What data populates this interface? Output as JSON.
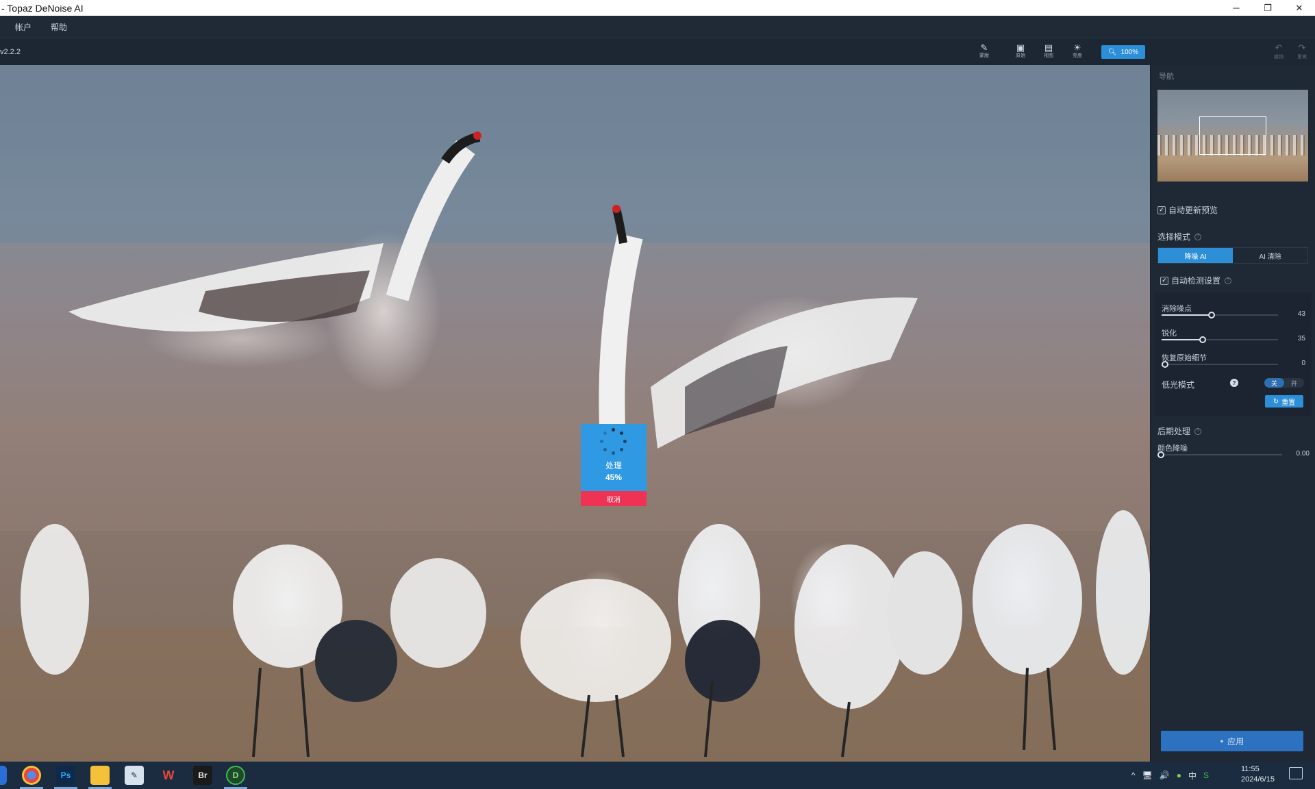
{
  "window": {
    "title": "- Topaz DeNoise AI",
    "controls": [
      "─",
      "❐",
      "✕"
    ]
  },
  "menu": [
    "帐户",
    "帮助"
  ],
  "toolbar": {
    "version": "v2.2.2",
    "tools": [
      {
        "icon": "brush-icon",
        "glyph": "✎",
        "label": "蒙版"
      },
      {
        "icon": "original-icon",
        "glyph": "▣",
        "label": "原始"
      },
      {
        "icon": "view-icon",
        "glyph": "▤",
        "label": "视图"
      },
      {
        "icon": "brightness-icon",
        "glyph": "☀",
        "label": "亮度"
      }
    ],
    "zoom": "100%",
    "undo_label": "撤销",
    "redo_label": "重做"
  },
  "processing": {
    "label": "处理",
    "percent": "45%",
    "progress": 0.45,
    "cancel": "取消"
  },
  "panel": {
    "navigator_title": "导航",
    "auto_update_preview": "自动更新预览",
    "auto_update_checked": true,
    "select_mode_label": "选择模式",
    "modes": [
      "降噪 AI",
      "AI 清除"
    ],
    "active_mode": 0,
    "auto_detect": "自动检测设置",
    "auto_detect_checked": true,
    "sliders": [
      {
        "name": "消除噪点",
        "value": "43",
        "fraction": 0.43
      },
      {
        "name": "锐化",
        "value": "35",
        "fraction": 0.35
      },
      {
        "name": "恢复原始细节",
        "value": "0",
        "fraction": 0.0
      }
    ],
    "low_light": {
      "label": "低光模式",
      "off": "关",
      "on": "开",
      "state": "off"
    },
    "reset": "重置",
    "post_processing": "后期处理",
    "color_noise": {
      "name": "颜色降噪",
      "value": "0.00",
      "fraction": 0.0
    },
    "apply": "应用"
  },
  "taskbar": {
    "apps": [
      {
        "name": "chrome-icon",
        "label": "",
        "color": "#e8453c"
      },
      {
        "name": "photoshop-icon",
        "label": "Ps",
        "color": "#0d2a4a"
      },
      {
        "name": "file-explorer-icon",
        "label": "",
        "color": "#f3c13a"
      },
      {
        "name": "paint-icon",
        "label": "",
        "color": "#d6e2ee"
      },
      {
        "name": "wps-icon",
        "label": "W",
        "color": "#1c2c40"
      },
      {
        "name": "bridge-icon",
        "label": "Br",
        "color": "#1a1a1a"
      },
      {
        "name": "denoise-icon",
        "label": "D",
        "color": "#1f4a2a"
      }
    ],
    "tray": [
      "^",
      "🖥",
      "🔊",
      "●",
      "中",
      "S"
    ],
    "time": "11:55",
    "date": "2024/6/15"
  }
}
